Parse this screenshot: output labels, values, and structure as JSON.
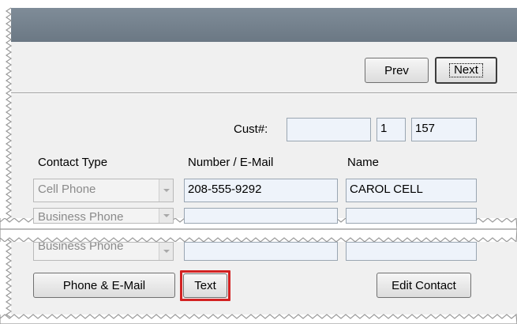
{
  "nav": {
    "prev_label": "Prev",
    "next_label": "Next"
  },
  "customer": {
    "cust_label": "Cust#:",
    "cust_field_1": "",
    "cust_field_2": "1",
    "cust_field_3": "157"
  },
  "contacts": {
    "headers": {
      "contact_type": "Contact Type",
      "number_email": "Number / E-Mail",
      "name": "Name"
    },
    "rows": [
      {
        "type": "Cell Phone",
        "number": "208-555-9292",
        "name": "CAROL CELL"
      },
      {
        "type": "Business Phone",
        "number": "",
        "name": ""
      },
      {
        "type": "Business Phone",
        "number": "",
        "name": ""
      }
    ]
  },
  "actions": {
    "phone_email_label": "Phone & E-Mail",
    "text_label": "Text",
    "edit_contact_label": "Edit Contact"
  },
  "colors": {
    "highlight": "#d32222",
    "field_bg": "#eef3fa",
    "titlebar": "#77838f"
  }
}
